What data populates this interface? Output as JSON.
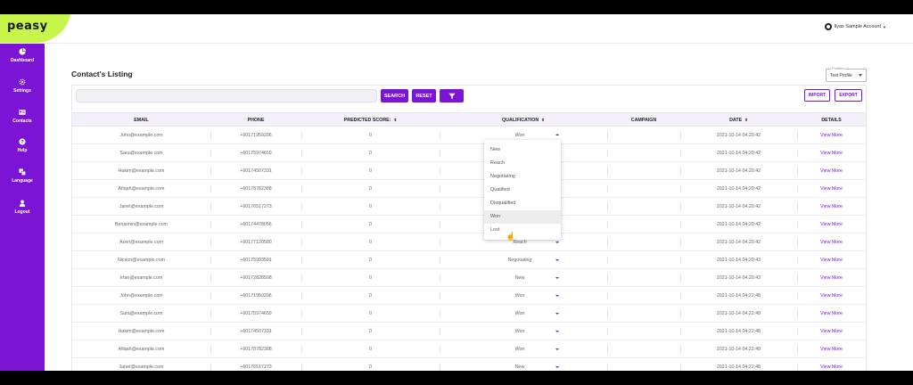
{
  "brand": {
    "name": "peasy",
    "accent": "#7c14d6",
    "logo_bg": "#c8f54a"
  },
  "account": {
    "label": "Ilyas Sample Account",
    "icon": "user-circle-icon"
  },
  "sidebar": {
    "items": [
      {
        "label": "Dashboard",
        "icon": "pie-chart-icon"
      },
      {
        "label": "Settings",
        "icon": "gear-icon"
      },
      {
        "label": "Contacts",
        "icon": "contact-card-icon"
      },
      {
        "label": "Help",
        "icon": "help-icon"
      },
      {
        "label": "Language",
        "icon": "translate-icon"
      },
      {
        "label": "Logout",
        "icon": "person-icon"
      }
    ]
  },
  "page": {
    "title": "Contact's Listing"
  },
  "profile": {
    "legend": "Profiles",
    "value": "Test Profile"
  },
  "toolbar": {
    "search_label": "SEARCH",
    "reset_label": "RESET",
    "filter_icon": "filter-icon",
    "import_label": "IMPORT",
    "export_label": "EXPORT"
  },
  "table": {
    "columns": {
      "email": "EMAIL",
      "phone": "PHONE",
      "score": "PREDICTED SCORE:",
      "qualification": "QUALIFICATION",
      "campaign": "CAMPAIGN",
      "date": "DATE",
      "details": "DETAILS"
    },
    "details_link": "View More",
    "rows": [
      {
        "email": "John@example.com",
        "phone": "+60171959206",
        "score": "0",
        "qualification": "Won",
        "campaign": "",
        "date": "2021-10-14 04:20:42"
      },
      {
        "email": "Sara@example.com",
        "phone": "+60175974659",
        "score": "0",
        "qualification": "",
        "campaign": "",
        "date": "2021-10-14 04:20:42"
      },
      {
        "email": "Hakim@example.com",
        "phone": "+60174507331",
        "score": "0",
        "qualification": "",
        "campaign": "",
        "date": "2021-10-14 04:20:42"
      },
      {
        "email": "Afiqah@example.com",
        "phone": "+60178782388",
        "score": "0",
        "qualification": "",
        "campaign": "",
        "date": "2021-10-14 04:20:42"
      },
      {
        "email": "Janet@example.com",
        "phone": "+60176517273",
        "score": "0",
        "qualification": "",
        "campaign": "",
        "date": "2021-10-14 04:20:42"
      },
      {
        "email": "Benjamin@example.com",
        "phone": "+60174478056",
        "score": "0",
        "qualification": "",
        "campaign": "",
        "date": "2021-10-14 04:20:42"
      },
      {
        "email": "Azeri@example.com",
        "phone": "+60177120580",
        "score": "0",
        "qualification": "Reach",
        "campaign": "",
        "date": "2021-10-14 04:20:42"
      },
      {
        "email": "Nicson@example.com",
        "phone": "+60175993581",
        "score": "0",
        "qualification": "Negotiating",
        "campaign": "",
        "date": "2021-10-14 04:20:43"
      },
      {
        "email": "Irfan@example.com",
        "phone": "+60172828508",
        "score": "0",
        "qualification": "New",
        "campaign": "",
        "date": "2021-10-14 04:20:43"
      },
      {
        "email": "John@example.com",
        "phone": "+60171959206",
        "score": "0",
        "qualification": "Won",
        "campaign": "",
        "date": "2021-10-14 04:22:48"
      },
      {
        "email": "Sara@example.com",
        "phone": "+60175974659",
        "score": "0",
        "qualification": "Won",
        "campaign": "",
        "date": "2021-10-14 04:22:48"
      },
      {
        "email": "Hakim@example.com",
        "phone": "+60174507331",
        "score": "0",
        "qualification": "Won",
        "campaign": "",
        "date": "2021-10-14 04:22:48"
      },
      {
        "email": "Afiqah@example.com",
        "phone": "+60178782388",
        "score": "0",
        "qualification": "Won",
        "campaign": "",
        "date": "2021-10-14 04:22:48"
      },
      {
        "email": "Janet@example.com",
        "phone": "+60176517273",
        "score": "0",
        "qualification": "New",
        "campaign": "",
        "date": "2021-10-14 04:22:48"
      }
    ]
  },
  "dropdown": {
    "options": [
      "New",
      "Reach",
      "Negotiating",
      "Qualified",
      "Disqualified",
      "Won",
      "Lost"
    ],
    "hovered": "Won"
  }
}
